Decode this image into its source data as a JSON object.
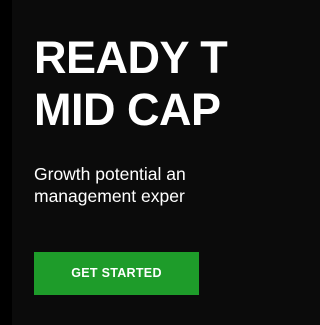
{
  "hero": {
    "headline_line1": "READY T",
    "headline_line2": "MID CAP",
    "subhead_line1": "Growth potential an",
    "subhead_line2": "management exper",
    "cta_label": "GET STARTED"
  },
  "colors": {
    "background": "#0b0b0b",
    "text": "#ffffff",
    "cta_background": "#1e9c2a"
  }
}
